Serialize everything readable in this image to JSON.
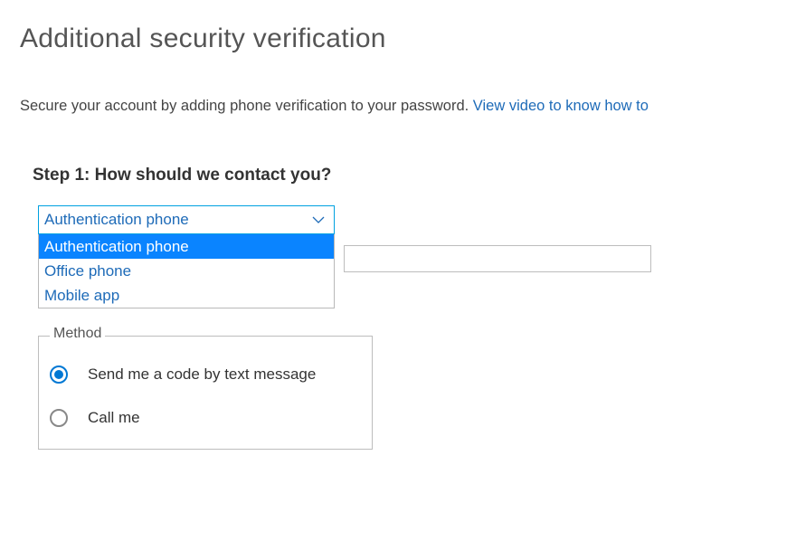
{
  "page": {
    "title": "Additional security verification",
    "intro_text": "Secure your account by adding phone verification to your password. ",
    "intro_link": "View video to know how to"
  },
  "step1": {
    "heading": "Step 1: How should we contact you?",
    "contact_method_dropdown": {
      "selected": "Authentication phone",
      "options": [
        "Authentication phone",
        "Office phone",
        "Mobile app"
      ]
    },
    "country_select_value": "",
    "phone_input_value": ""
  },
  "method_fieldset": {
    "legend": "Method",
    "options": [
      {
        "label": "Send me a code by text message",
        "checked": true
      },
      {
        "label": "Call me",
        "checked": false
      }
    ]
  }
}
